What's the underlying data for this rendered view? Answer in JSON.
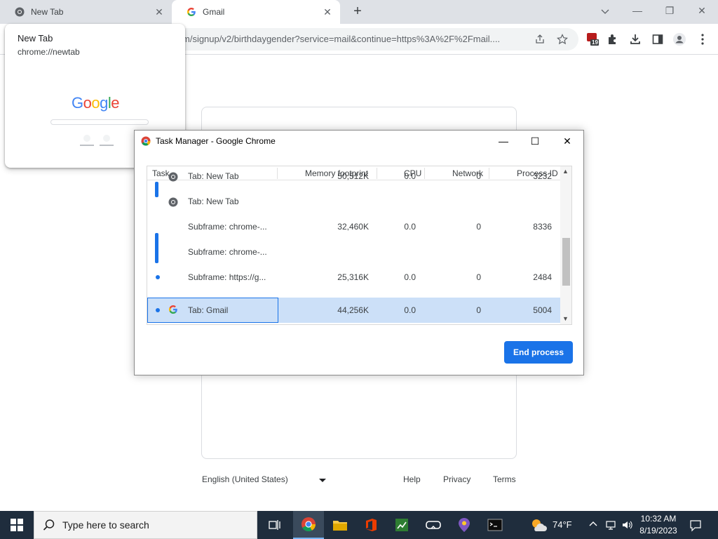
{
  "browser": {
    "tabs": [
      {
        "title": "New Tab"
      },
      {
        "title": "Gmail"
      }
    ],
    "new_tab_symbol": "+",
    "window_controls": {
      "minimize": "—",
      "maximize": "❐",
      "close": "✕"
    },
    "address_url": "m/signup/v2/birthdaygender?service=mail&continue=https%3A%2F%2Fmail....",
    "extension_badge": "19"
  },
  "hover_card": {
    "title": "New Tab",
    "url": "chrome://newtab",
    "preview_logo": "Google"
  },
  "task_manager": {
    "title": "Task Manager - Google Chrome",
    "columns": [
      "Task",
      "Memory footprint",
      "CPU",
      "Network",
      "Process ID"
    ],
    "rows": [
      {
        "task": "Tab: New Tab",
        "memory": "50,512K",
        "cpu": "0.0",
        "network": "0",
        "pid": "3232"
      },
      {
        "task": "Tab: New Tab",
        "memory": "",
        "cpu": "",
        "network": "",
        "pid": ""
      },
      {
        "task": "Subframe: chrome-...",
        "memory": "32,460K",
        "cpu": "0.0",
        "network": "0",
        "pid": "8336"
      },
      {
        "task": "Subframe: chrome-...",
        "memory": "",
        "cpu": "",
        "network": "",
        "pid": ""
      },
      {
        "task": "Subframe: https://g...",
        "memory": "25,316K",
        "cpu": "0.0",
        "network": "0",
        "pid": "2484"
      },
      {
        "task": "Tab: Gmail",
        "memory": "44,256K",
        "cpu": "0.0",
        "network": "0",
        "pid": "5004"
      }
    ],
    "selected_row": 5,
    "end_process_label": "End process",
    "controls": {
      "minimize": "—",
      "maximize": "☐",
      "close": "✕"
    }
  },
  "gmail_page": {
    "language": "English (United States)",
    "footer_links": [
      "Help",
      "Privacy",
      "Terms"
    ]
  },
  "taskbar": {
    "search_placeholder": "Type here to search",
    "weather_temp": "74°F",
    "time": "10:32 AM",
    "date": "8/19/2023"
  },
  "colors": {
    "accent": "#1a73e8",
    "selected_row": "#cce0f8",
    "taskbar": "#1f2d3d"
  }
}
